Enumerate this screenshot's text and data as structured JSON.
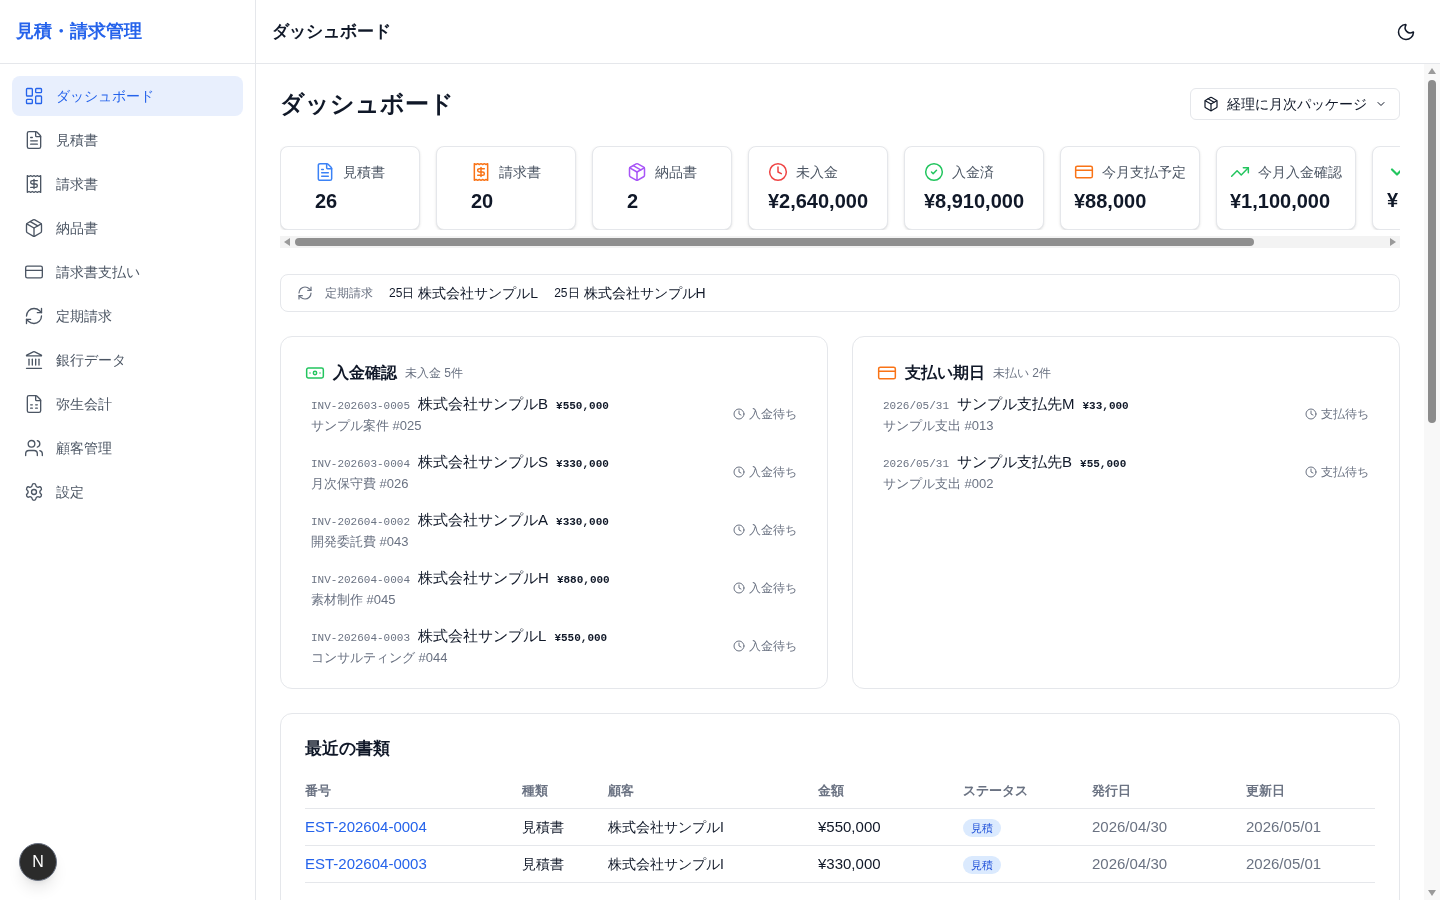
{
  "sidebar": {
    "title": "見積・請求管理",
    "items": [
      {
        "label": "ダッシュボード",
        "selected": true
      },
      {
        "label": "見積書",
        "selected": false
      },
      {
        "label": "請求書",
        "selected": false
      },
      {
        "label": "納品書",
        "selected": false
      },
      {
        "label": "請求書支払い",
        "selected": false
      },
      {
        "label": "定期請求",
        "selected": false
      },
      {
        "label": "銀行データ",
        "selected": false
      },
      {
        "label": "弥生会計",
        "selected": false
      },
      {
        "label": "顧客管理",
        "selected": false
      },
      {
        "label": "設定",
        "selected": false
      }
    ],
    "avatar": "N"
  },
  "header": {
    "title": "ダッシュボード"
  },
  "page": {
    "title": "ダッシュボード",
    "package_button": "経理に月次パッケージ"
  },
  "stats": [
    {
      "label": "見積書",
      "value": "26",
      "color": "#3b82f6"
    },
    {
      "label": "請求書",
      "value": "20",
      "color": "#f97316"
    },
    {
      "label": "納品書",
      "value": "2",
      "color": "#a855f7"
    },
    {
      "label": "未入金",
      "value": "¥2,640,000",
      "color": "#ef4444"
    },
    {
      "label": "入金済",
      "value": "¥8,910,000",
      "color": "#22c55e"
    },
    {
      "label": "今月支払予定",
      "value": "¥88,000",
      "color": "#f97316"
    },
    {
      "label": "今月入金確認",
      "value": "¥1,100,000",
      "color": "#22c55e"
    },
    {
      "value": "¥",
      "color": "#22c55e"
    }
  ],
  "recurring": {
    "label": "定期請求",
    "items": [
      {
        "day": "25日",
        "name": "株式会社サンプルL"
      },
      {
        "day": "25日",
        "name": "株式会社サンプルH"
      }
    ]
  },
  "receipts": {
    "title": "入金確認",
    "summary": "未入金 5件",
    "rows": [
      {
        "number": "INV-202603-0005",
        "party": "株式会社サンプルB",
        "amount": "¥550,000",
        "memo": "サンプル案件 #025",
        "status": "入金待ち"
      },
      {
        "number": "INV-202603-0004",
        "party": "株式会社サンプルS",
        "amount": "¥330,000",
        "memo": "月次保守費 #026",
        "status": "入金待ち"
      },
      {
        "number": "INV-202604-0002",
        "party": "株式会社サンプルA",
        "amount": "¥330,000",
        "memo": "開発委託費 #043",
        "status": "入金待ち"
      },
      {
        "number": "INV-202604-0004",
        "party": "株式会社サンプルH",
        "amount": "¥880,000",
        "memo": "素材制作 #045",
        "status": "入金待ち"
      },
      {
        "number": "INV-202604-0003",
        "party": "株式会社サンプルL",
        "amount": "¥550,000",
        "memo": "コンサルティング #044",
        "status": "入金待ち"
      }
    ]
  },
  "payments": {
    "title": "支払い期日",
    "summary": "未払い 2件",
    "rows": [
      {
        "number": "2026/05/31",
        "party": "サンプル支払先M",
        "amount": "¥33,000",
        "memo": "サンプル支出 #013",
        "status": "支払待ち"
      },
      {
        "number": "2026/05/31",
        "party": "サンプル支払先B",
        "amount": "¥55,000",
        "memo": "サンプル支出 #002",
        "status": "支払待ち"
      }
    ]
  },
  "recent": {
    "title": "最近の書類",
    "columns": [
      "番号",
      "種類",
      "顧客",
      "金額",
      "ステータス",
      "発行日",
      "更新日"
    ],
    "rows": [
      {
        "number": "EST-202604-0004",
        "type": "見積書",
        "customer": "株式会社サンプルI",
        "amount": "¥550,000",
        "status": {
          "label": "見積",
          "kind": "estimate"
        },
        "issued": "2026/04/30",
        "updated": "2026/05/01"
      },
      {
        "number": "EST-202604-0003",
        "type": "見積書",
        "customer": "株式会社サンプルI",
        "amount": "¥330,000",
        "status": {
          "label": "見積",
          "kind": "estimate"
        },
        "issued": "2026/04/30",
        "updated": "2026/05/01"
      }
    ]
  }
}
